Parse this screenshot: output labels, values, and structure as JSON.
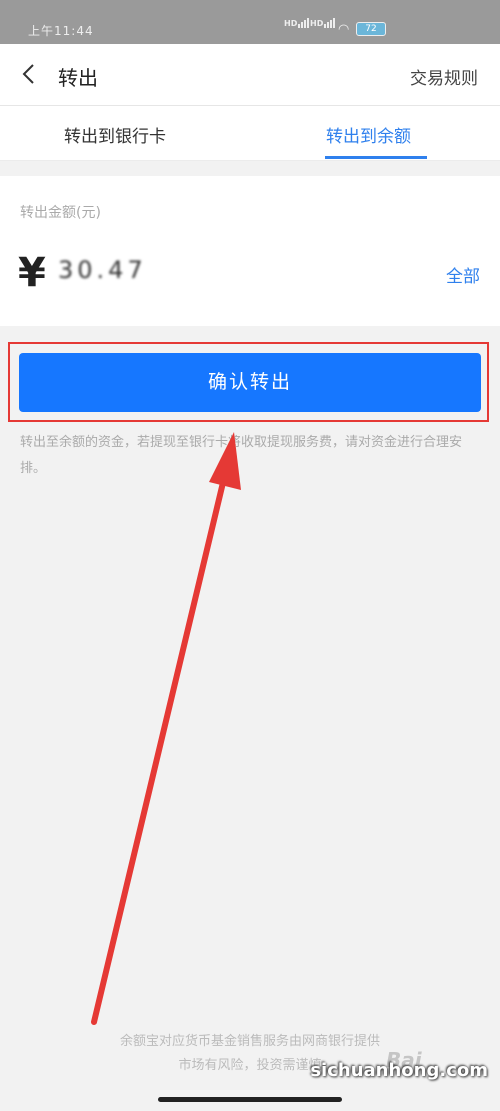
{
  "status_bar": {
    "time": "上午11:44",
    "hd1": "HD",
    "hd2": "HD",
    "battery": "72"
  },
  "header": {
    "title": "转出",
    "rules": "交易规则"
  },
  "tabs": [
    {
      "label": "转出到银行卡",
      "active": false
    },
    {
      "label": "转出到余额",
      "active": true
    }
  ],
  "card": {
    "label": "转出金额(元)",
    "currency": "¥",
    "amount": "30.47",
    "all": "全部"
  },
  "confirm_button": "确认转出",
  "notice": "转出至余额的资金，若提现至银行卡将收取提现服务费，请对资金进行合理安排。",
  "footer": {
    "line1": "余额宝对应货币基金销售服务由网商银行提供",
    "line2": "市场有风险，投资需谨慎"
  },
  "watermarks": {
    "baidu": "Bai",
    "site": "sichuanhong.com"
  },
  "colors": {
    "accent": "#1677ff",
    "annotation": "#e53935"
  }
}
